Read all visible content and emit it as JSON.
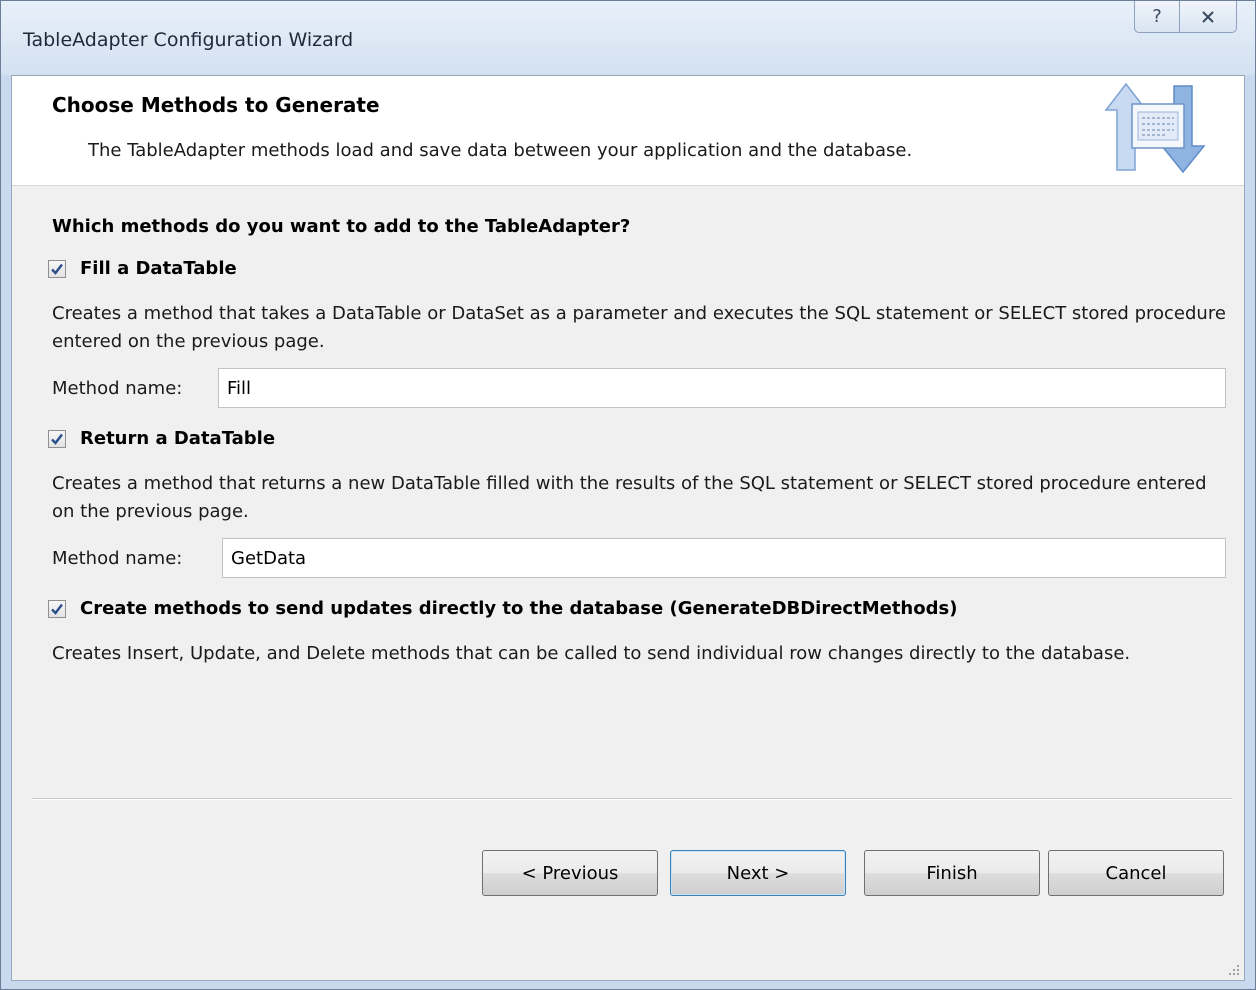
{
  "window": {
    "title": "TableAdapter Configuration Wizard",
    "help_glyph": "?",
    "close_glyph": "X"
  },
  "header": {
    "title": "Choose Methods to Generate",
    "subtitle": "The TableAdapter methods load and save data between your application and the database."
  },
  "content": {
    "question": "Which methods do you want to add to the TableAdapter?",
    "fill_option": {
      "label": "Fill a DataTable",
      "checked": true,
      "description": "Creates a method that takes a DataTable or DataSet as a parameter and executes the SQL statement or SELECT stored procedure entered on the previous page.",
      "method_label": "Method name:",
      "method_value": "Fill"
    },
    "return_option": {
      "label": "Return a DataTable",
      "checked": true,
      "description": "Creates a method that returns a new DataTable filled with the results of the SQL statement or SELECT stored procedure entered on the previous page.",
      "method_label": "Method name:",
      "method_value": "GetData"
    },
    "direct_option": {
      "label": "Create methods to send updates directly to the database (GenerateDBDirectMethods)",
      "checked": true,
      "description": "Creates Insert, Update, and Delete methods that can be called to send individual row changes directly to the database."
    }
  },
  "buttons": {
    "previous": "< Previous",
    "next": "Next >",
    "finish": "Finish",
    "cancel": "Cancel"
  },
  "colors": {
    "accent": "#3c7fb1",
    "check_mark": "#2b4f8a"
  }
}
